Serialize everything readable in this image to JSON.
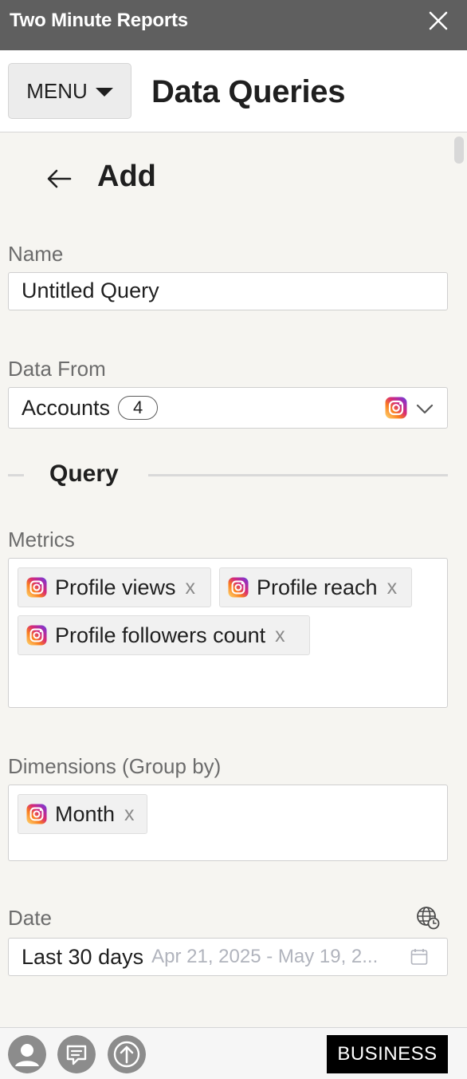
{
  "app": {
    "title": "Two Minute Reports"
  },
  "header": {
    "menu_label": "MENU",
    "page_title": "Data Queries"
  },
  "form": {
    "heading": "Add",
    "name": {
      "label": "Name",
      "value": "Untitled Query"
    },
    "data_from": {
      "label": "Data From",
      "value": "Accounts",
      "count": "4",
      "source_icon": "instagram-icon"
    },
    "section_title": "Query",
    "metrics": {
      "label": "Metrics",
      "chips": [
        {
          "label": "Profile views",
          "remove": "x",
          "icon": "instagram-icon"
        },
        {
          "label": "Profile reach",
          "remove": "x",
          "icon": "instagram-icon"
        },
        {
          "label": "Profile followers count",
          "remove": "x",
          "icon": "instagram-icon"
        }
      ]
    },
    "dimensions": {
      "label": "Dimensions (Group by)",
      "chips": [
        {
          "label": "Month",
          "remove": "x",
          "icon": "instagram-icon"
        }
      ]
    },
    "date": {
      "label": "Date",
      "value": "Last 30 days",
      "range": "Apr 21, 2025 - May 19, 2..."
    }
  },
  "footer": {
    "plan_label": "BUSINESS"
  },
  "colors": {
    "titlebar": "#5f5f5f",
    "background": "#f6f5f1",
    "business_button": "#000000"
  }
}
